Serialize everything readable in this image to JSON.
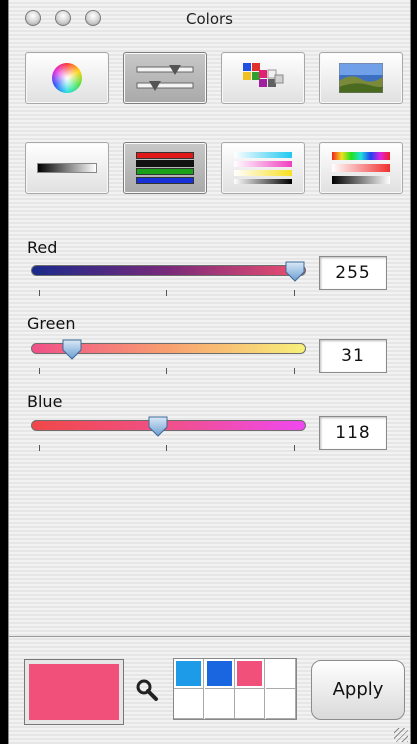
{
  "window": {
    "title": "Colors"
  },
  "modes": {
    "top": [
      "color-wheel",
      "color-sliders",
      "color-palettes",
      "image-palettes"
    ],
    "bottom": [
      "grayscale-slider",
      "rgb-sliders",
      "cmyk-sliders",
      "hsb-sliders"
    ]
  },
  "sliders": [
    {
      "label": "Red",
      "value": "255",
      "fraction": 1.0
    },
    {
      "label": "Green",
      "value": "31",
      "fraction": 0.12
    },
    {
      "label": "Blue",
      "value": "118",
      "fraction": 0.46
    }
  ],
  "current_color": "#f0507a",
  "swatches": [
    "#1e9be8",
    "#1a66e0",
    "#f0507a",
    "#ffffff",
    "#ffffff",
    "#ffffff",
    "#ffffff",
    "#ffffff"
  ],
  "apply_label": "Apply",
  "icons": {
    "magnifier": "magnifier-icon"
  }
}
